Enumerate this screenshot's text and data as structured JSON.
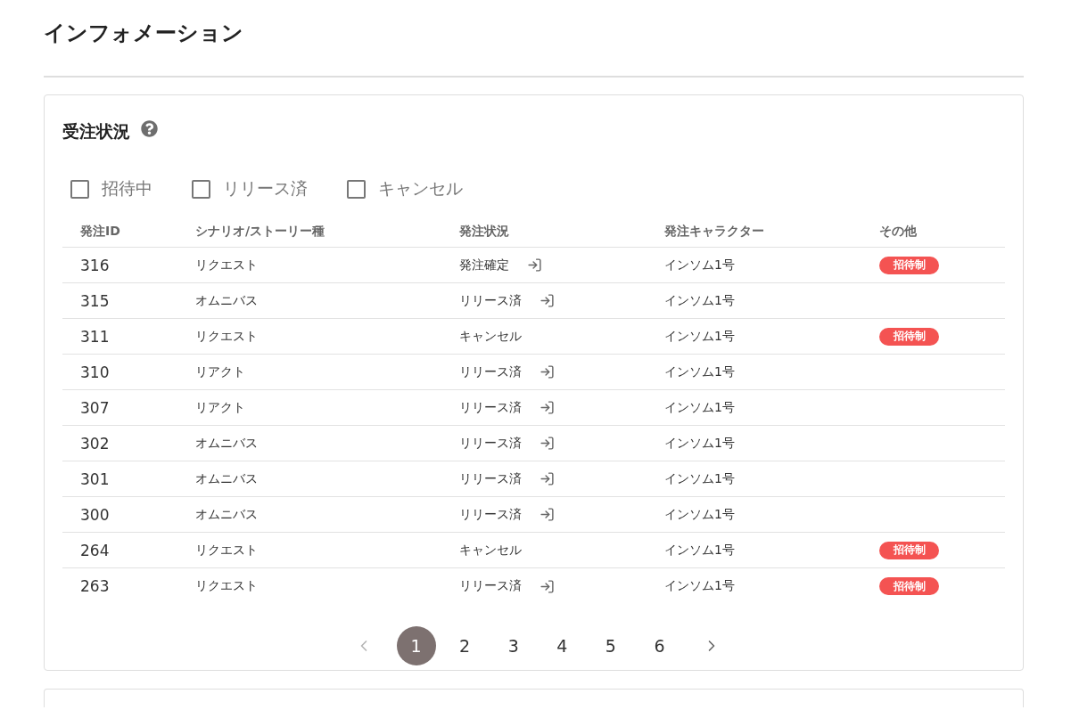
{
  "page": {
    "title": "インフォメーション"
  },
  "order_status": {
    "title": "受注状況",
    "filters": [
      {
        "label": "招待中",
        "checked": false
      },
      {
        "label": "リリース済",
        "checked": false
      },
      {
        "label": "キャンセル",
        "checked": false
      }
    ],
    "table": {
      "columns": [
        "発注ID",
        "シナリオ/ストーリー種",
        "発注状況",
        "発注キャラクター",
        "その他"
      ],
      "rows": [
        {
          "id": "316",
          "type": "リクエスト",
          "status": "発注確定",
          "has_link": true,
          "character": "インソム1号",
          "tag": "招待制"
        },
        {
          "id": "315",
          "type": "オムニバス",
          "status": "リリース済",
          "has_link": true,
          "character": "インソム1号"
        },
        {
          "id": "311",
          "type": "リクエスト",
          "status": "キャンセル",
          "has_link": false,
          "character": "インソム1号",
          "tag": "招待制"
        },
        {
          "id": "310",
          "type": "リアクト",
          "status": "リリース済",
          "has_link": true,
          "character": "インソム1号"
        },
        {
          "id": "307",
          "type": "リアクト",
          "status": "リリース済",
          "has_link": true,
          "character": "インソム1号"
        },
        {
          "id": "302",
          "type": "オムニバス",
          "status": "リリース済",
          "has_link": true,
          "character": "インソム1号"
        },
        {
          "id": "301",
          "type": "オムニバス",
          "status": "リリース済",
          "has_link": true,
          "character": "インソム1号"
        },
        {
          "id": "300",
          "type": "オムニバス",
          "status": "リリース済",
          "has_link": true,
          "character": "インソム1号"
        },
        {
          "id": "264",
          "type": "リクエスト",
          "status": "キャンセル",
          "has_link": false,
          "character": "インソム1号",
          "tag": "招待制"
        },
        {
          "id": "263",
          "type": "リクエスト",
          "status": "リリース済",
          "has_link": true,
          "character": "インソム1号",
          "tag": "招待制"
        }
      ]
    },
    "pagination": {
      "previous_disabled": true,
      "next_disabled": false,
      "pages": [
        {
          "label": "1",
          "selected": true
        },
        {
          "label": "2",
          "selected": false
        },
        {
          "label": "3",
          "selected": false
        },
        {
          "label": "4",
          "selected": false
        },
        {
          "label": "5",
          "selected": false
        },
        {
          "label": "6",
          "selected": false
        }
      ]
    }
  }
}
